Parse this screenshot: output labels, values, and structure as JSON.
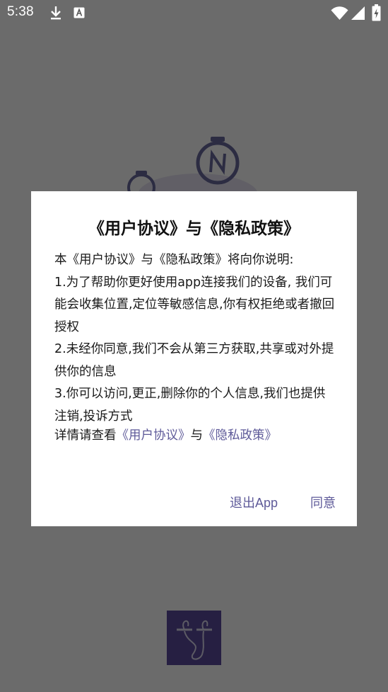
{
  "status_bar": {
    "time": "5:38",
    "icons": [
      "download-icon",
      "keyboard-a-icon",
      "wifi-icon",
      "signal-icon",
      "battery-charging-icon"
    ]
  },
  "dialog": {
    "title": "《用户协议》与《隐私政策》",
    "intro": "本《用户协议》与《隐私政策》将向你说明:",
    "points": [
      "1.为了帮助你更好使用app连接我们的设备, 我们可能会收集位置,定位等敏感信息,你有权拒绝或者撤回授权",
      "2.未经你同意,我们不会从第三方获取,共享或对外提供你的信息",
      "3.你可以访问,更正,删除你的个人信息,我们也提供注销,投诉方式"
    ],
    "details_prefix": "详情请查看",
    "user_agreement_link": "《用户协议》",
    "details_joiner": "与",
    "privacy_policy_link": "《隐私政策》",
    "exit_button": "退出App",
    "agree_button": "同意"
  },
  "colors": {
    "accent": "#5e5a99",
    "scrim": "#6b6b6b",
    "logo": "#5b4a9e"
  }
}
